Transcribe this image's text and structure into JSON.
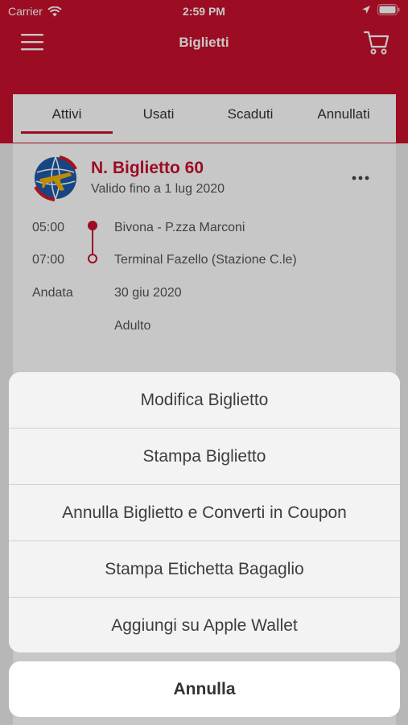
{
  "status_bar": {
    "carrier": "Carrier",
    "time": "2:59 PM"
  },
  "nav": {
    "title": "Biglietti",
    "menu_icon": "hamburger-icon",
    "cart_icon": "cart-icon"
  },
  "tabs": [
    {
      "label": "Attivi",
      "active": true
    },
    {
      "label": "Usati",
      "active": false
    },
    {
      "label": "Scaduti",
      "active": false
    },
    {
      "label": "Annullati",
      "active": false
    }
  ],
  "ticket": {
    "title": "N. Biglietto 60",
    "valid_until": "Valido fino a 1 lug 2020",
    "departure_time": "05:00",
    "departure_place": "Bivona - P.zza Marconi",
    "arrival_time": "07:00",
    "arrival_place": "Terminal Fazello (Stazione C.le)",
    "direction_label": "Andata",
    "date": "30 giu 2020",
    "passenger_type": "Adulto"
  },
  "action_sheet": {
    "actions": [
      "Modifica Biglietto",
      "Stampa Biglietto",
      "Annulla Biglietto e Converti in Coupon",
      "Stampa Etichetta Bagaglio",
      "Aggiungi su Apple Wallet"
    ],
    "cancel_label": "Annulla"
  },
  "colors": {
    "brand_red": "#c8102e",
    "sheet_bg": "#f3f3f3",
    "text_gray": "#555555"
  }
}
